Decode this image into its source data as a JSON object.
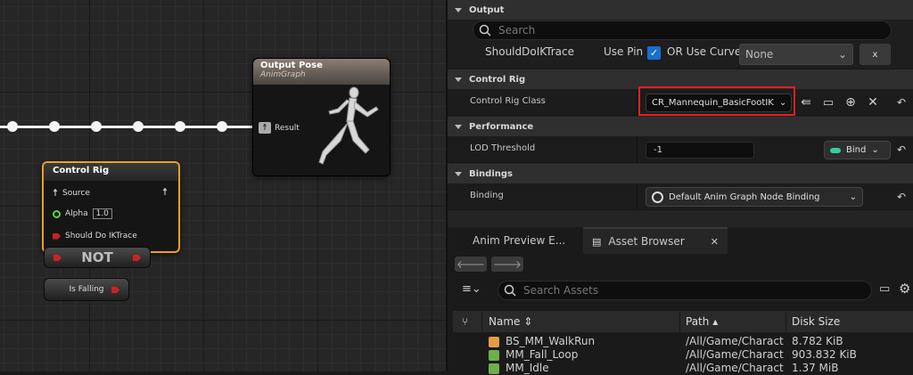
{
  "graph": {
    "output_pose": {
      "title": "Output Pose",
      "subtitle": "AnimGraph",
      "pin_result": "Result"
    },
    "control_rig": {
      "title": "Control Rig",
      "pin_source": "Source",
      "pin_alpha": "Alpha",
      "alpha_value": "1.0",
      "pin_should": "Should Do IKTrace"
    },
    "not_node": "NOT",
    "is_falling": "Is Falling"
  },
  "details": {
    "output_label": "Output",
    "search_placeholder": "Search",
    "should_label": "ShouldDoIKTrace",
    "use_pin_label": "Use Pin",
    "or_curve_label": "OR Use Curve",
    "curve_value": "None",
    "x_label": "x",
    "control_rig_section": "Control Rig",
    "control_rig_class_label": "Control Rig Class",
    "control_rig_class_value": "CR_Mannequin_BasicFootIK",
    "performance_section": "Performance",
    "lod_label": "LOD Threshold",
    "lod_value": "-1",
    "bind_label": "Bind",
    "bindings_section": "Bindings",
    "binding_label": "Binding",
    "binding_value": "Default Anim Graph Node Binding",
    "accent": "#1a6fd0",
    "highlight": "#e02020"
  },
  "browser": {
    "tab1": "Anim Preview E...",
    "tab2": "Asset Browser",
    "search_placeholder": "Search Assets",
    "col_name": "Name",
    "col_path": "Path",
    "col_size": "Disk Size",
    "rows": [
      {
        "name": "BS_MM_WalkRun",
        "path": "/All/Game/Charact",
        "size": "8.782 KiB",
        "color": "#e89b45"
      },
      {
        "name": "MM_Fall_Loop",
        "path": "/All/Game/Charact",
        "size": "903.832 KiB",
        "color": "#6fae4a"
      },
      {
        "name": "MM_Idle",
        "path": "/All/Game/Charact",
        "size": "1.37 MiB",
        "color": "#6fae4a"
      }
    ]
  }
}
